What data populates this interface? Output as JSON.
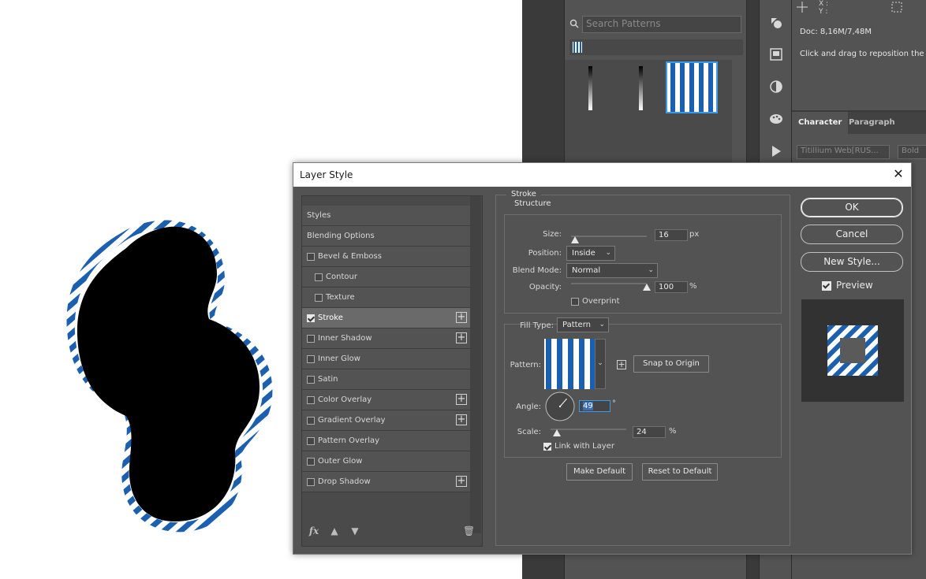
{
  "patterns_panel": {
    "search_placeholder": "Search Patterns"
  },
  "info_panel": {
    "x_label": "X :",
    "y_label": "Y :",
    "doc": "Doc: 8,16M/7,48M",
    "hint": "Click and drag to reposition the patt"
  },
  "character_panel": {
    "tabs": [
      "Character",
      "Paragraph"
    ],
    "font_family": "Titillium Web[RUS...",
    "font_style": "Bold"
  },
  "dialog": {
    "title": "Layer Style",
    "close": "✕",
    "styles_list": [
      {
        "label": "Styles",
        "checkbox": false,
        "checked": false,
        "plus": false,
        "indent": 0
      },
      {
        "label": "Blending Options",
        "checkbox": false,
        "checked": false,
        "plus": false,
        "indent": 0
      },
      {
        "label": "Bevel & Emboss",
        "checkbox": true,
        "checked": false,
        "plus": false,
        "indent": 0
      },
      {
        "label": "Contour",
        "checkbox": true,
        "checked": false,
        "plus": false,
        "indent": 1
      },
      {
        "label": "Texture",
        "checkbox": true,
        "checked": false,
        "plus": false,
        "indent": 1
      },
      {
        "label": "Stroke",
        "checkbox": true,
        "checked": true,
        "plus": true,
        "indent": 0,
        "active": true
      },
      {
        "label": "Inner Shadow",
        "checkbox": true,
        "checked": false,
        "plus": true,
        "indent": 0
      },
      {
        "label": "Inner Glow",
        "checkbox": true,
        "checked": false,
        "plus": false,
        "indent": 0
      },
      {
        "label": "Satin",
        "checkbox": true,
        "checked": false,
        "plus": false,
        "indent": 0
      },
      {
        "label": "Color Overlay",
        "checkbox": true,
        "checked": false,
        "plus": true,
        "indent": 0
      },
      {
        "label": "Gradient Overlay",
        "checkbox": true,
        "checked": false,
        "plus": true,
        "indent": 0
      },
      {
        "label": "Pattern Overlay",
        "checkbox": true,
        "checked": false,
        "plus": false,
        "indent": 0
      },
      {
        "label": "Outer Glow",
        "checkbox": true,
        "checked": false,
        "plus": false,
        "indent": 0
      },
      {
        "label": "Drop Shadow",
        "checkbox": true,
        "checked": false,
        "plus": true,
        "indent": 0
      }
    ],
    "footer": {
      "fx": "fx",
      "up": "▲",
      "down": "▼",
      "trash": "🗑"
    },
    "stroke": {
      "group_label": "Stroke",
      "structure_label": "Structure",
      "size_label": "Size:",
      "size_value": "16",
      "size_unit": "px",
      "size_fraction": 0.05,
      "position_label": "Position:",
      "position_value": "Inside",
      "blend_mode_label": "Blend Mode:",
      "blend_mode_value": "Normal",
      "opacity_label": "Opacity:",
      "opacity_value": "100",
      "opacity_unit": "%",
      "opacity_fraction": 1.0,
      "overprint_label": "Overprint",
      "overprint_checked": false,
      "fill_type_label": "Fill Type:",
      "fill_type_value": "Pattern",
      "pattern_label": "Pattern:",
      "snap_to_origin": "Snap to Origin",
      "angle_label": "Angle:",
      "angle_value": "49",
      "angle_unit": "°",
      "scale_label": "Scale:",
      "scale_value": "24",
      "scale_unit": "%",
      "scale_fraction": 0.08,
      "link_with_layer_label": "Link with Layer",
      "link_with_layer_checked": true,
      "make_default": "Make Default",
      "reset_to_default": "Reset to Default"
    },
    "buttons": {
      "ok": "OK",
      "cancel": "Cancel",
      "new_style": "New Style...",
      "preview_label": "Preview",
      "preview_checked": true
    }
  },
  "colors": {
    "pattern_blue": "#1a5fb0",
    "selection_blue": "#3a9be8"
  }
}
